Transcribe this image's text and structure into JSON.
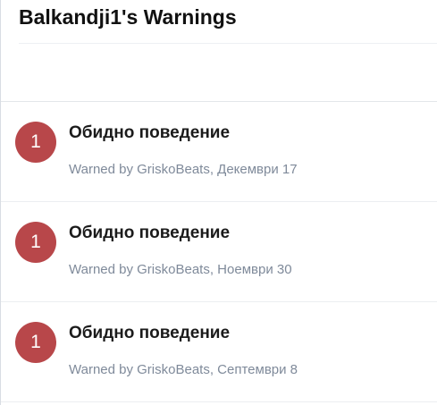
{
  "page": {
    "title": "Balkandji1's Warnings"
  },
  "colors": {
    "badge": "#b8474a",
    "meta_text": "#7f8a9a"
  },
  "warnings": [
    {
      "points": "1",
      "reason": "Обидно поведение",
      "meta": "Warned by GriskoBeats, Декември 17"
    },
    {
      "points": "1",
      "reason": "Обидно поведение",
      "meta": "Warned by GriskoBeats, Ноември 30"
    },
    {
      "points": "1",
      "reason": "Обидно поведение",
      "meta": "Warned by GriskoBeats, Септември 8"
    }
  ]
}
